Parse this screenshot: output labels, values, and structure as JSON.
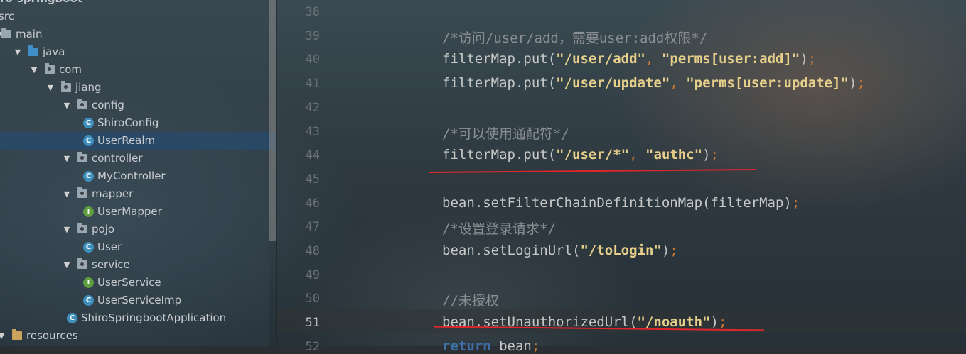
{
  "project_tree": {
    "root_partial": "ro-springboot",
    "nodes": [
      {
        "label": "src",
        "depth": 0,
        "type": "none"
      },
      {
        "label": "main",
        "depth": 0,
        "type": "folder"
      },
      {
        "label": "java",
        "depth": 1,
        "type": "folder-blue",
        "expanded": true
      },
      {
        "label": "com",
        "depth": 2,
        "type": "package",
        "expanded": true
      },
      {
        "label": "jiang",
        "depth": 3,
        "type": "package",
        "expanded": true
      },
      {
        "label": "config",
        "depth": 4,
        "type": "package",
        "expanded": true
      },
      {
        "label": "ShiroConfig",
        "depth": 5,
        "type": "class"
      },
      {
        "label": "UserRealm",
        "depth": 5,
        "type": "class",
        "selected": true
      },
      {
        "label": "controller",
        "depth": 4,
        "type": "package",
        "expanded": true
      },
      {
        "label": "MyController",
        "depth": 5,
        "type": "class"
      },
      {
        "label": "mapper",
        "depth": 4,
        "type": "package",
        "expanded": true
      },
      {
        "label": "UserMapper",
        "depth": 5,
        "type": "interface"
      },
      {
        "label": "pojo",
        "depth": 4,
        "type": "package",
        "expanded": true
      },
      {
        "label": "User",
        "depth": 5,
        "type": "class"
      },
      {
        "label": "service",
        "depth": 4,
        "type": "package",
        "expanded": true
      },
      {
        "label": "UserService",
        "depth": 5,
        "type": "interface"
      },
      {
        "label": "UserServiceImp",
        "depth": 5,
        "type": "class"
      },
      {
        "label": "ShiroSpringbootApplication",
        "depth": 4,
        "type": "app"
      },
      {
        "label": "resources",
        "depth": 0,
        "type": "folder-res",
        "expanded": true
      }
    ]
  },
  "editor": {
    "lines": [
      {
        "n": "38",
        "code": ""
      },
      {
        "n": "39",
        "code": "/*访问/user/add，需要user:add权限*/"
      },
      {
        "n": "40",
        "code": "filterMap.put(\"/user/add\", \"perms[user:add]\");"
      },
      {
        "n": "41",
        "code": "filterMap.put(\"/user/update\", \"perms[user:update]\");"
      },
      {
        "n": "42",
        "code": ""
      },
      {
        "n": "43",
        "code": "/*可以使用通配符*/"
      },
      {
        "n": "44",
        "code": "filterMap.put(\"/user/*\", \"authc\");"
      },
      {
        "n": "45",
        "code": ""
      },
      {
        "n": "46",
        "code": "bean.setFilterChainDefinitionMap(filterMap);"
      },
      {
        "n": "47",
        "code": "/*设置登录请求*/"
      },
      {
        "n": "48",
        "code": "bean.setLoginUrl(\"/toLogin\");"
      },
      {
        "n": "49",
        "code": ""
      },
      {
        "n": "50",
        "code": "//未授权"
      },
      {
        "n": "51",
        "code": "bean.setUnauthorizedUrl(\"/noauth\");"
      },
      {
        "n": "52",
        "code": "return bean;"
      }
    ],
    "current_line": "51",
    "annotation_color": "#e0262b"
  }
}
